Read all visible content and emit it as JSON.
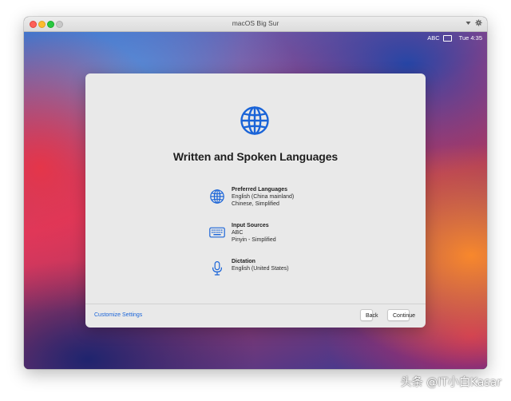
{
  "window": {
    "title": "macOS Big Sur"
  },
  "menubar": {
    "input_source": "ABC",
    "clock": "Tue 4:35"
  },
  "panel": {
    "title": "Written and Spoken Languages",
    "items": [
      {
        "heading": "Preferred Languages",
        "lines": [
          "English (China mainland)",
          "Chinese, Simplified"
        ],
        "icon": "globe-icon"
      },
      {
        "heading": "Input Sources",
        "lines": [
          "ABC",
          "Pinyin - Simplified"
        ],
        "icon": "keyboard-icon"
      },
      {
        "heading": "Dictation",
        "lines": [
          "English (United States)"
        ],
        "icon": "microphone-icon"
      }
    ],
    "footer": {
      "link": "Customize Settings",
      "back": "Back",
      "continue": "Continue"
    }
  },
  "watermark": "头条 @IT小白Kasar",
  "colors": {
    "accent": "#1a64d8",
    "panel_bg": "#e9e9e9",
    "close": "#fe5f57",
    "minimize": "#febc2e",
    "maximize": "#28c840"
  }
}
